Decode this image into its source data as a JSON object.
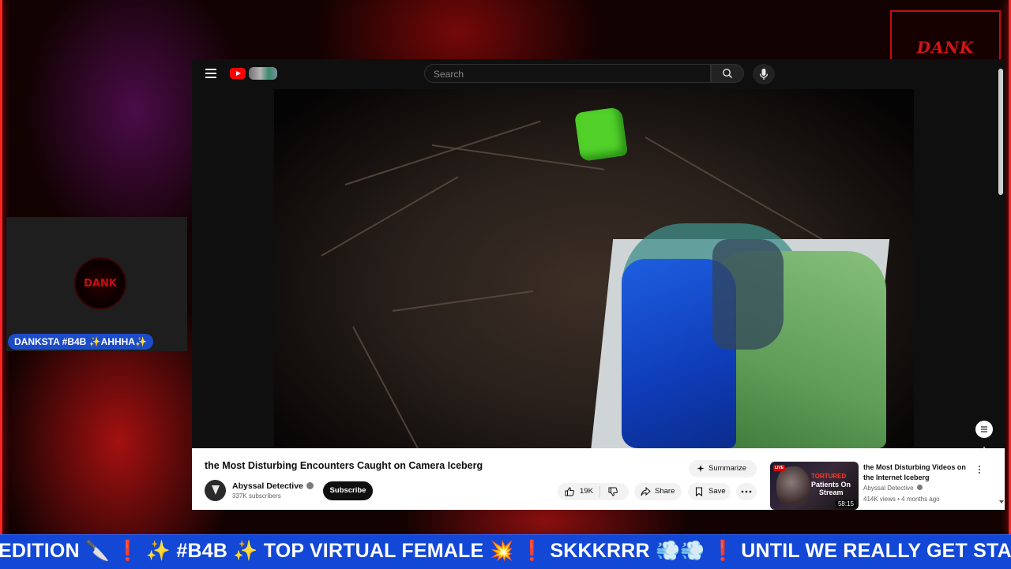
{
  "overlay": {
    "logo_text": "DANK",
    "camera_label": "DANKSTA #B4B ✨AHHHA✨",
    "avatar_text": "DANK",
    "ticker_text": "EDITION 🔪 ❗ ✨ #B4B ✨ TOP VIRTUAL FEMALE 💥 ❗ SKKKRRR 💨💨 ❗ UNTIL WE REALLY GET STARTED",
    "accent_color": "#ff2424",
    "ticker_color": "#1348d6"
  },
  "youtube": {
    "search_placeholder": "Search",
    "icons": {
      "menu": "hamburger-icon",
      "logo": "youtube-logo-icon",
      "search": "search-icon",
      "mic": "mic-icon"
    },
    "video": {
      "title": "the Most Disturbing Encounters Caught on Camera Iceberg",
      "channel": "Abyssal Detective",
      "subscribers": "337K subscribers",
      "subscribe_label": "Subscribe",
      "likes": "19K",
      "share_label": "Share",
      "save_label": "Save",
      "summarize_label": "Summarize"
    },
    "recommended": {
      "title": "the Most Disturbing Videos on the Internet Iceberg",
      "channel": "Abyssal Detective",
      "meta": "414K views • 4 months ago",
      "duration": "58:15",
      "thumb_live": "LIVE",
      "thumb_line1": "TORTURED",
      "thumb_line2": "Patients On",
      "thumb_line3": "Stream"
    }
  }
}
